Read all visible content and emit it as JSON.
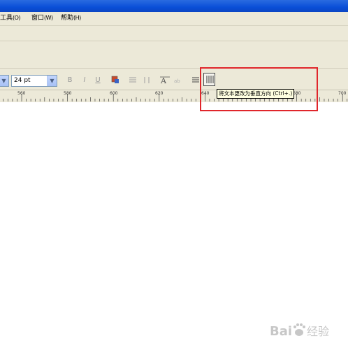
{
  "menubar": {
    "items": [
      {
        "label": "工具",
        "accel": "(O)"
      },
      {
        "label": "窗口",
        "accel": "(W)"
      },
      {
        "label": "帮助",
        "accel": "(H)"
      }
    ]
  },
  "property_bar": {
    "font_size": "24 pt",
    "tooltip": "将文本更改为垂直方向 (Ctrl+.)"
  },
  "ruler": {
    "labels": [
      "560",
      "580",
      "600",
      "620",
      "640",
      "660",
      "680",
      "700"
    ]
  },
  "watermark": {
    "text": "Bai 经验"
  },
  "colors": {
    "titlebar": "#0a4fd8",
    "chrome": "#ece9d8",
    "highlight": "#e0262b",
    "tooltip_bg": "#ffffe1"
  }
}
